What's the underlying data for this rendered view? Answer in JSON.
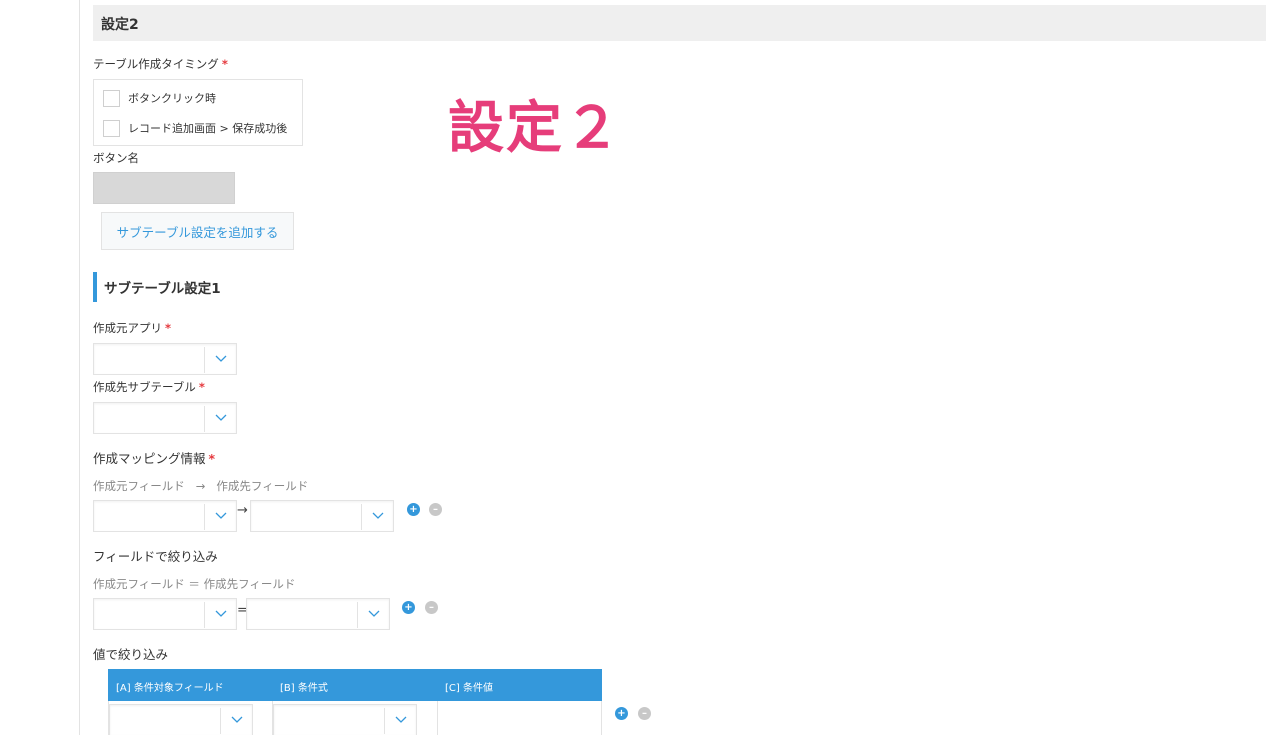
{
  "section": {
    "title": "設定2"
  },
  "overlay": {
    "big_title": "設定２"
  },
  "timing": {
    "label": "テーブル作成タイミング",
    "required_mark": "*",
    "options": [
      {
        "label": "ボタンクリック時",
        "checked": false
      },
      {
        "label": "レコード追加画面 > 保存成功後",
        "checked": false
      }
    ]
  },
  "button_name": {
    "label": "ボタン名",
    "value": ""
  },
  "add_subtable_button": {
    "label": "サブテーブル設定を追加する"
  },
  "subtable": {
    "heading": "サブテーブル設定1",
    "source_app": {
      "label": "作成元アプリ",
      "required_mark": "*",
      "value": ""
    },
    "dest_subtable": {
      "label": "作成先サブテーブル",
      "required_mark": "*",
      "value": ""
    },
    "mapping": {
      "label": "作成マッピング情報",
      "required_mark": "*",
      "hint_left": "作成元フィールド",
      "hint_arrow": "→",
      "hint_right": "作成先フィールド",
      "operator": "→"
    },
    "field_filter": {
      "label": "フィールドで絞り込み",
      "hint": "作成元フィールド ＝ 作成先フィールド",
      "operator": "="
    },
    "value_filter": {
      "label": "値で絞り込み",
      "columns": [
        "[A] 条件対象フィールド",
        "[B] 条件式",
        "[C] 条件値"
      ]
    }
  },
  "buttons": {
    "plus": "+",
    "minus": "–"
  },
  "colors": {
    "accent": "#3498db",
    "required": "#e5393e",
    "big_title": "#e63d7a"
  }
}
